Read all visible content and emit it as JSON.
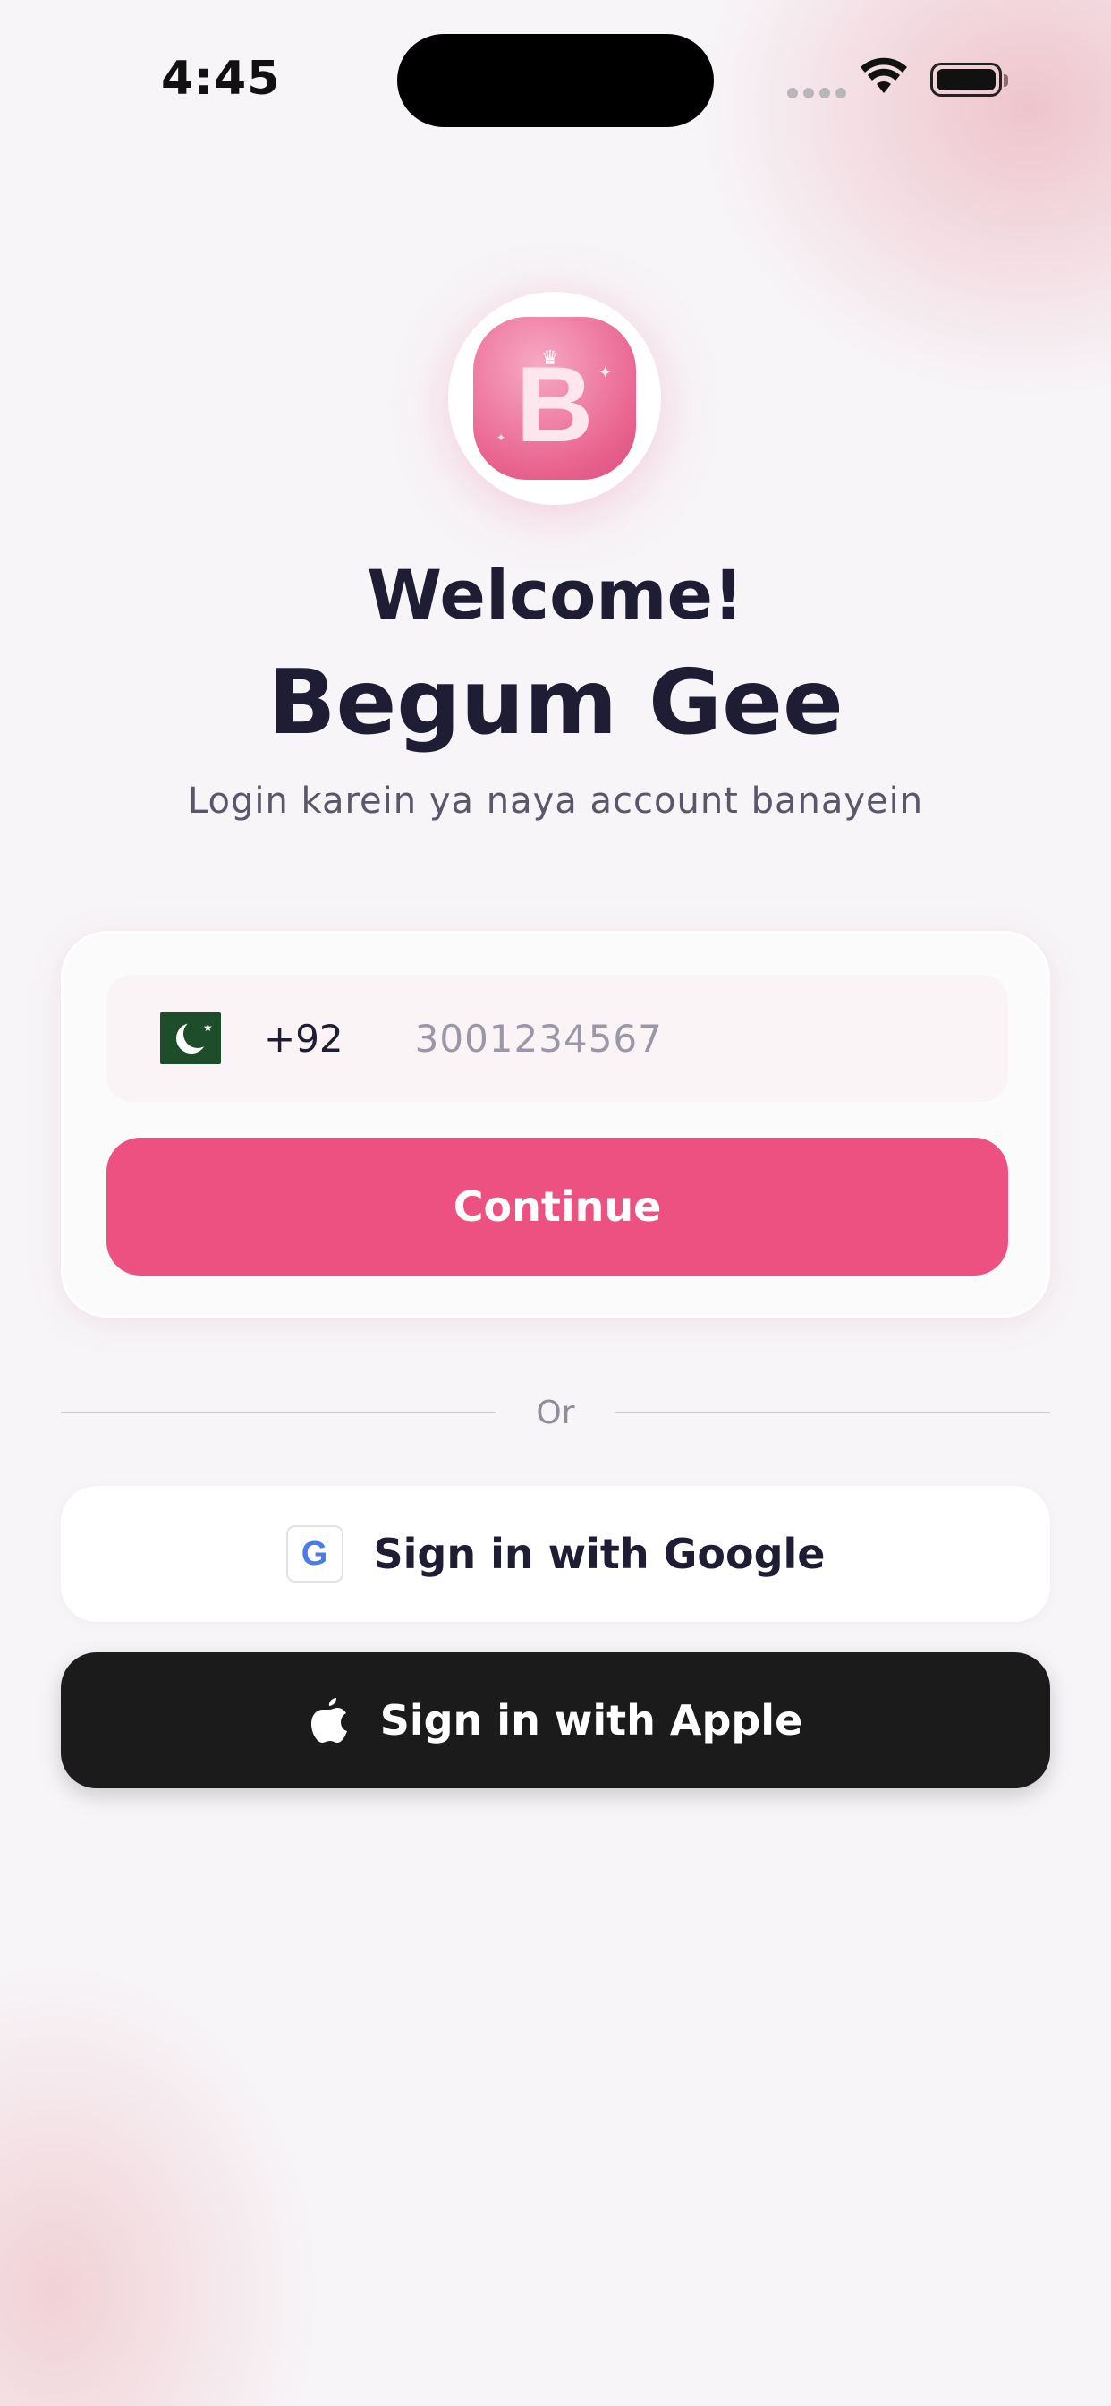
{
  "status_bar": {
    "time": "4:45"
  },
  "logo": {
    "letter": "B",
    "icon": "begum-gee-logo-icon"
  },
  "header": {
    "welcome": "Welcome!",
    "brand": "Begum Gee",
    "subtitle": "Login karein ya naya account banayein"
  },
  "phone_form": {
    "country_flag_icon": "pakistan-flag-icon",
    "country_code": "+92",
    "phone_placeholder": "3001234567",
    "phone_value": "",
    "continue_label": "Continue"
  },
  "divider": {
    "label": "Or"
  },
  "social": {
    "google_label": "Sign in with Google",
    "google_icon_letter": "G",
    "apple_label": "Sign in with Apple"
  },
  "colors": {
    "accent": "#ec5181",
    "text_primary": "#1f1d33",
    "apple_button": "#1b1b1b"
  }
}
